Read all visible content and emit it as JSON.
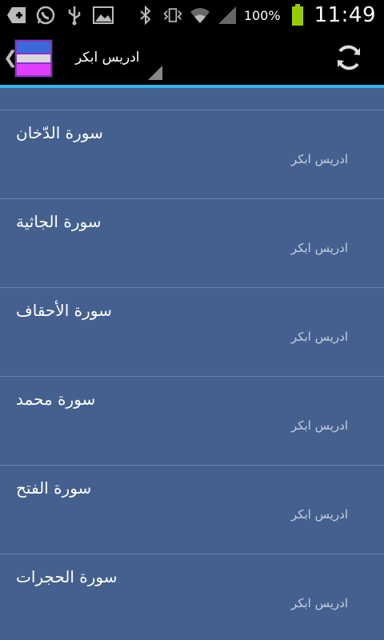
{
  "status_bar": {
    "battery_percent": "100%",
    "time": "11:49",
    "icons": [
      "add-notification-icon",
      "whatsapp-icon",
      "usb-icon",
      "image-icon",
      "bluetooth-icon",
      "vibrate-icon",
      "wifi-icon",
      "signal-icon",
      "battery-icon"
    ]
  },
  "action_bar": {
    "title": "ادريس ابكر",
    "refresh_icon": "refresh-icon"
  },
  "list": {
    "items": [
      {
        "title": "سورة الدّخان",
        "subtitle": "ادريس ابكر"
      },
      {
        "title": "سورة الجاثية",
        "subtitle": "ادريس ابكر"
      },
      {
        "title": "سورة الأحقاف",
        "subtitle": "ادريس ابكر"
      },
      {
        "title": "سورة محمد",
        "subtitle": "ادريس ابكر"
      },
      {
        "title": "سورة الفتح",
        "subtitle": "ادريس ابكر"
      },
      {
        "title": "سورة الحجرات",
        "subtitle": "ادريس ابكر"
      }
    ]
  },
  "colors": {
    "list_background": "#44608e",
    "accent": "#33b5e5",
    "bar": "#000000"
  }
}
